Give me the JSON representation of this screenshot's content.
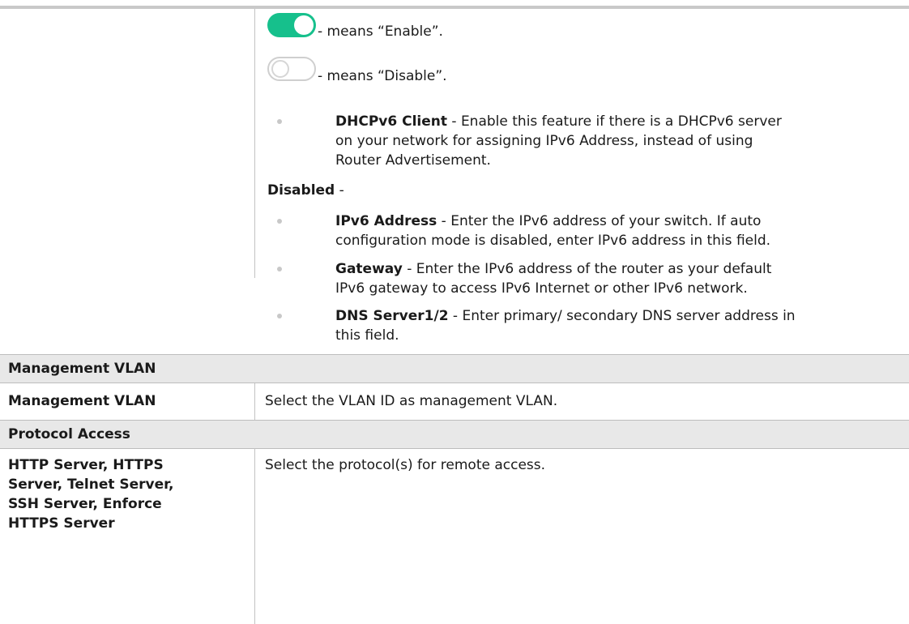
{
  "toggle_enable": {
    "state": "on",
    "color": "#16c08c",
    "text": " - means “Enable”."
  },
  "toggle_disable": {
    "state": "off",
    "text": " - means “Disable”."
  },
  "dhcpv6": {
    "term": "DHCPv6 Client",
    "lines": [
      " - Enable this feature if there is a DHCPv6 server",
      "on your network for assigning IPv6 Address, instead of using",
      "Router Advertisement."
    ]
  },
  "disabled_heading": {
    "term": "Disabled",
    "suffix": " -"
  },
  "ipv6_address": {
    "term": "IPv6 Address",
    "lines": [
      " - Enter the IPv6 address of your switch. If auto",
      "configuration mode is disabled, enter IPv6 address in this field."
    ]
  },
  "gateway": {
    "term": "Gateway",
    "lines": [
      " - Enter the IPv6 address of the router as your default",
      "IPv6 gateway to access IPv6 Internet or other IPv6 network."
    ]
  },
  "dns_server": {
    "term": "DNS Server1/2",
    "lines": [
      " - Enter primary/ secondary DNS server address in",
      "this field."
    ]
  },
  "section_management_vlan": "Management VLAN",
  "row_management_vlan": {
    "label": "Management VLAN",
    "description": "Select the VLAN ID as management VLAN."
  },
  "section_protocol_access": "Protocol Access",
  "row_protocol": {
    "label_lines": [
      "HTTP Server, HTTPS",
      "Server, Telnet Server,",
      "SSH Server, Enforce",
      "HTTPS Server"
    ],
    "description": "Select the protocol(s) for remote access."
  }
}
